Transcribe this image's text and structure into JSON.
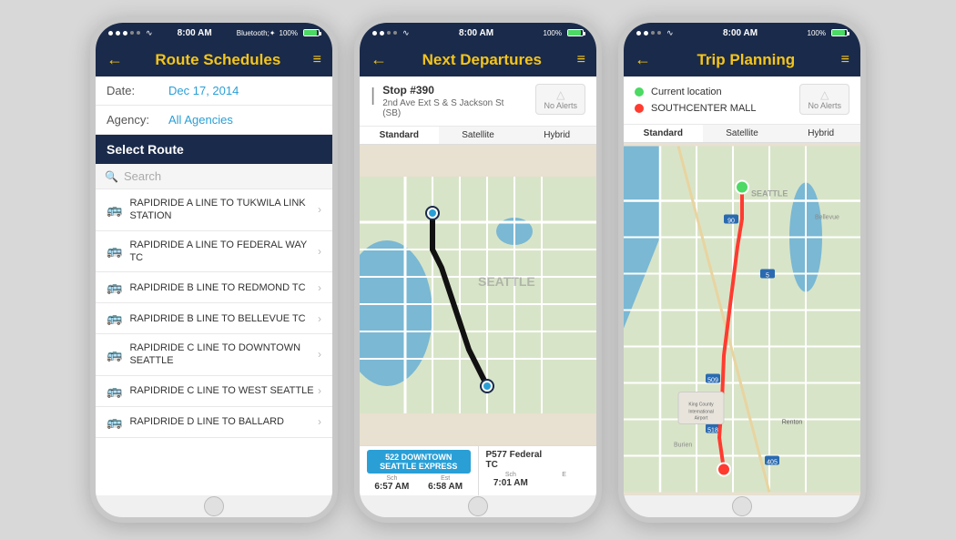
{
  "phone1": {
    "statusBar": {
      "dots": [
        "●",
        "●",
        "●",
        "○",
        "○"
      ],
      "wifi": "wifi",
      "time": "8:00 AM",
      "bluetooth": "B",
      "battery": "100%"
    },
    "header": {
      "title": "Route Schedules",
      "backIcon": "←",
      "menuIcon": "≡"
    },
    "dateRow": {
      "label": "Date:",
      "value": "Dec 17, 2014"
    },
    "agencyRow": {
      "label": "Agency:",
      "value": "All Agencies"
    },
    "selectRouteHeader": "Select Route",
    "searchPlaceholder": "Search",
    "routes": [
      {
        "text": "RAPIDRIDE A LINE TO TUKWILA LINK STATION"
      },
      {
        "text": "RAPIDRIDE A LINE TO FEDERAL WAY TC"
      },
      {
        "text": "RAPIDRIDE B LINE TO REDMOND TC"
      },
      {
        "text": "RAPIDRIDE B LINE TO BELLEVUE TC"
      },
      {
        "text": "RAPIDRIDE C LINE TO DOWNTOWN SEATTLE"
      },
      {
        "text": "RAPIDRIDE C LINE TO WEST SEATTLE"
      },
      {
        "text": "RAPIDRIDE D LINE TO BALLARD"
      }
    ]
  },
  "phone2": {
    "header": {
      "title": "Next Departures",
      "backIcon": "←",
      "menuIcon": "≡"
    },
    "stop": {
      "icon": "▐",
      "number": "Stop #390",
      "address": "2nd Ave Ext S & S Jackson St",
      "direction": "(SB)"
    },
    "noAlerts": "No Alerts",
    "mapTabs": [
      "Standard",
      "Satellite",
      "Hybrid"
    ],
    "departures": [
      {
        "route": "522  DOWNTOWN\nSEATTLE EXPRESS",
        "dest": "",
        "schLabel": "Sch",
        "schTime": "6:57 AM",
        "estLabel": "Est",
        "estTime": "6:58 AM"
      },
      {
        "route": "P577 Federal\nTC",
        "dest": "",
        "schLabel": "Sch",
        "schTime": "7:01 AM",
        "estLabel": "E",
        "estTime": ""
      }
    ]
  },
  "phone3": {
    "header": {
      "title": "Trip Planning",
      "backIcon": "←",
      "menuIcon": "≡"
    },
    "fromLabel": "Current location",
    "toLabel": "SOUTHCENTER MALL",
    "noAlerts": "No Alerts",
    "mapTabs": [
      "Standard",
      "Satellite",
      "Hybrid"
    ]
  }
}
